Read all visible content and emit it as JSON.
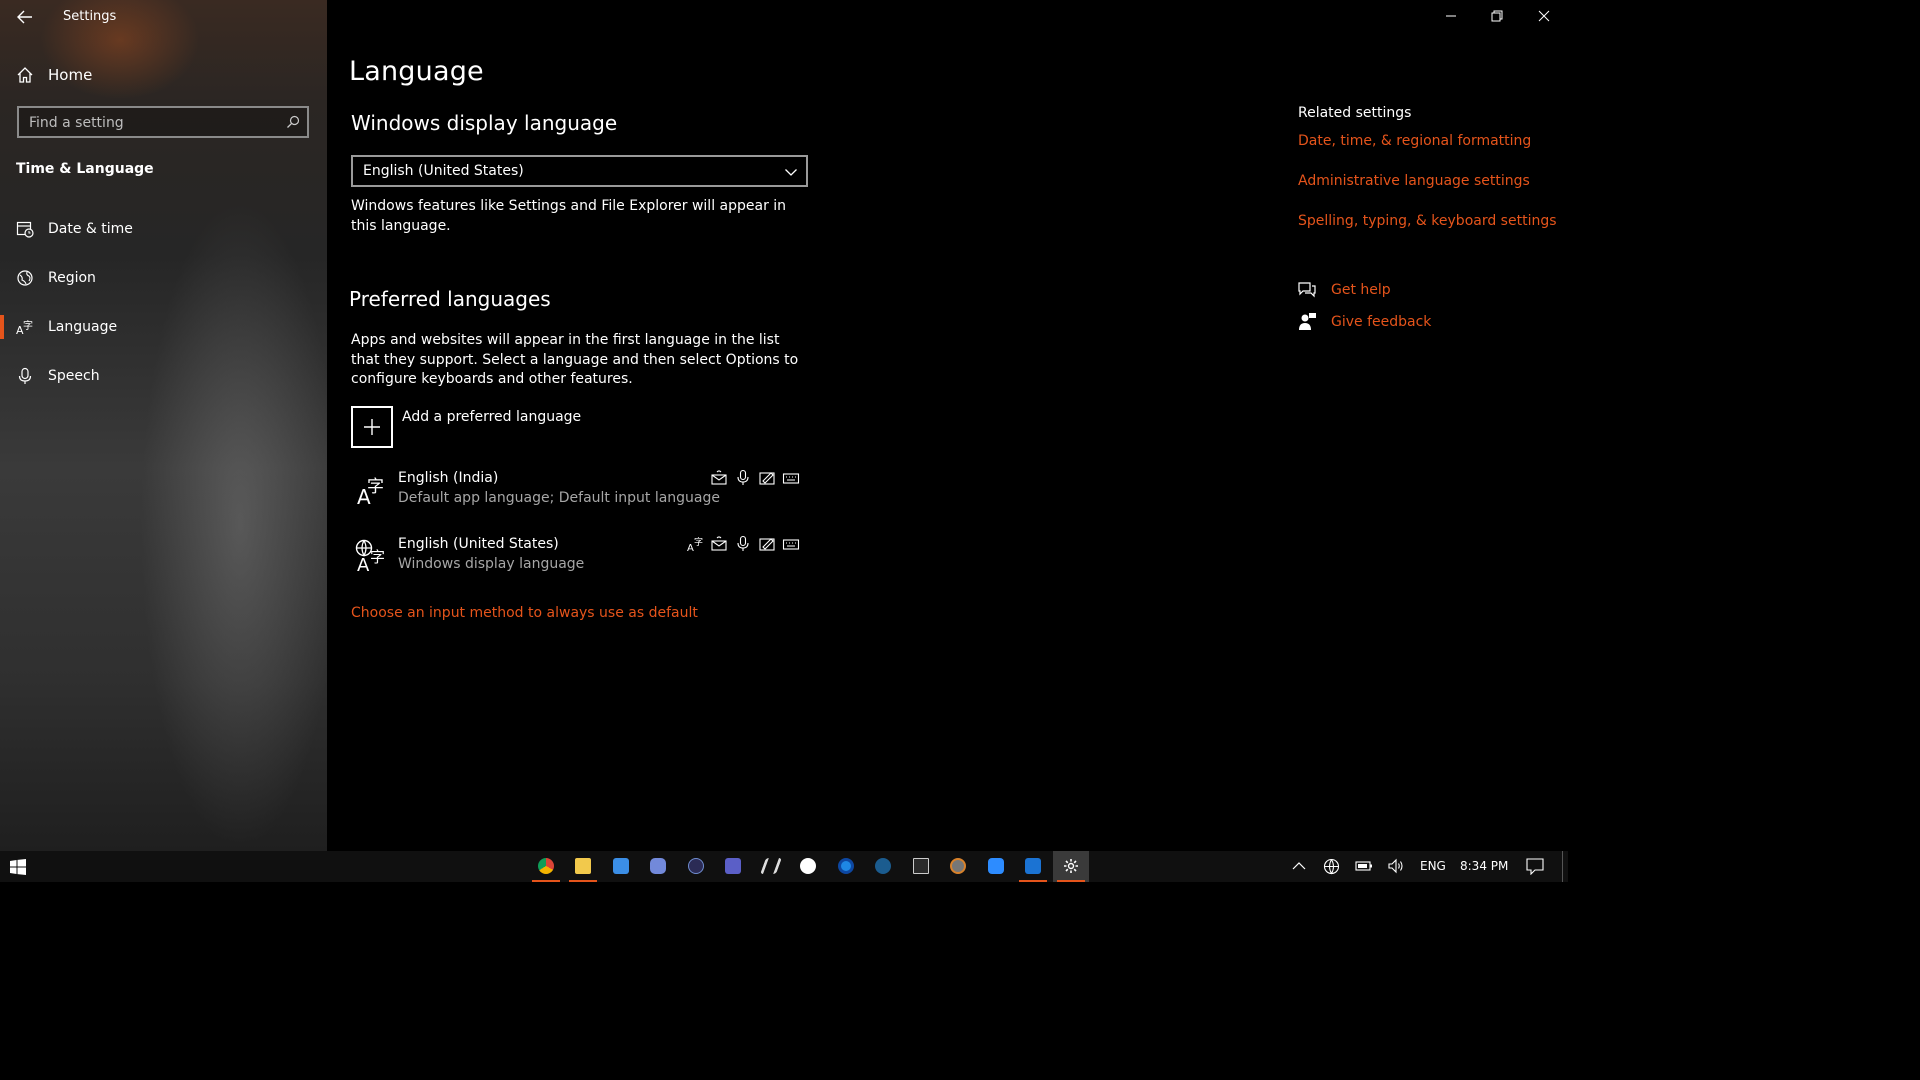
{
  "window": {
    "app_title": "Settings"
  },
  "sidebar": {
    "home_label": "Home",
    "search_placeholder": "Find a setting",
    "section_title": "Time & Language",
    "items": [
      {
        "label": "Date & time",
        "icon": "calendar-clock-icon"
      },
      {
        "label": "Region",
        "icon": "globe-region-icon"
      },
      {
        "label": "Language",
        "icon": "language-icon",
        "active": true
      },
      {
        "label": "Speech",
        "icon": "microphone-icon"
      }
    ]
  },
  "main": {
    "title": "Language",
    "display_language": {
      "heading": "Windows display language",
      "selected": "English (United States)",
      "description": "Windows features like Settings and File Explorer will appear in this language."
    },
    "preferred": {
      "heading": "Preferred languages",
      "description": "Apps and websites will appear in the first language in the list that they support. Select a language and then select Options to configure keyboards and other features.",
      "add_label": "Add a preferred language",
      "languages": [
        {
          "name": "English (India)",
          "sub": "Default app language; Default input language",
          "features": [
            "text-to-speech-icon",
            "speech-recognition-icon",
            "handwriting-icon",
            "keyboard-icon"
          ]
        },
        {
          "name": "English (United States)",
          "sub": "Windows display language",
          "features": [
            "language-pack-icon",
            "text-to-speech-icon",
            "speech-recognition-icon",
            "handwriting-icon",
            "keyboard-icon"
          ]
        }
      ],
      "input_method_link": "Choose an input method to always use as default"
    }
  },
  "related": {
    "title": "Related settings",
    "links": [
      "Date, time, & regional formatting",
      "Administrative language settings",
      "Spelling, typing, & keyboard settings"
    ],
    "help": "Get help",
    "feedback": "Give feedback"
  },
  "taskbar": {
    "apps": [
      "chrome",
      "file-explorer",
      "mail",
      "discord",
      "app",
      "teams",
      "editor",
      "xbox",
      "app-ring",
      "steam",
      "epic-games",
      "browser",
      "zoom",
      "photos",
      "settings"
    ],
    "language": "ENG",
    "time": "8:34 PM"
  },
  "colors": {
    "accent": "#e5541b",
    "background": "#000000"
  }
}
